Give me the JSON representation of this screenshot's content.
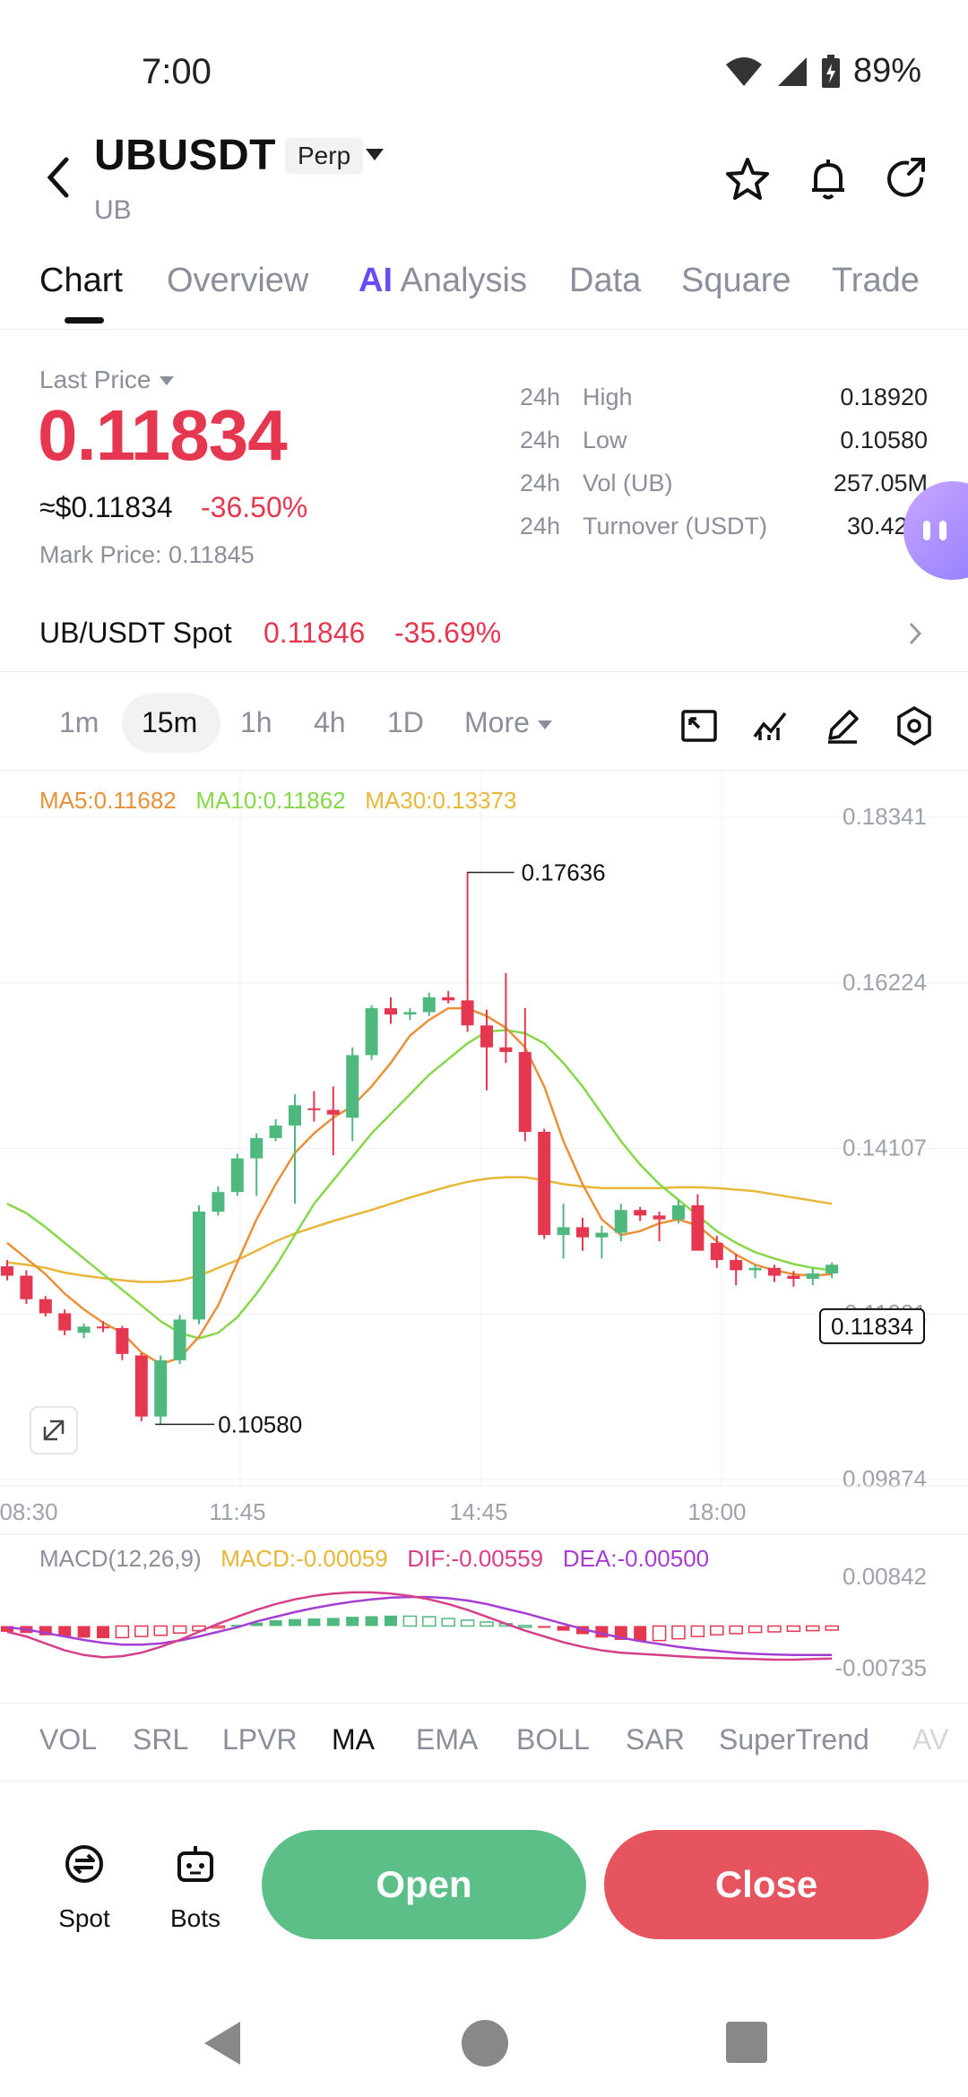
{
  "status_bar": {
    "time": "7:00",
    "battery": "89%"
  },
  "header": {
    "symbol": "UBUSDT",
    "contract_type": "Perp",
    "base": "UB"
  },
  "tabs": [
    "Chart",
    "Overview",
    "Analysis",
    "Data",
    "Square",
    "Trade"
  ],
  "tab_ai_prefix": "AI",
  "price": {
    "label": "Last Price",
    "last": "0.11834",
    "usd": "≈$0.11834",
    "change": "-36.50%",
    "mark": "Mark Price: 0.11845"
  },
  "stats": [
    {
      "period": "24h",
      "key": "High",
      "value": "0.18920"
    },
    {
      "period": "24h",
      "key": "Low",
      "value": "0.10580"
    },
    {
      "period": "24h",
      "key": "Vol (UB)",
      "value": "257.05M"
    },
    {
      "period": "24h",
      "key": "Turnover (USDT)",
      "value": "30.42M"
    }
  ],
  "spot": {
    "name": "UB/USDT Spot",
    "price": "0.11846",
    "change": "-35.69%"
  },
  "intervals": [
    "1m",
    "15m",
    "1h",
    "4h",
    "1D",
    "More"
  ],
  "selected_interval": "15m",
  "ma_legend": {
    "ma5": "MA5:0.11682",
    "ma10": "MA10:0.11862",
    "ma30": "MA30:0.13373"
  },
  "colors": {
    "up": "#4fb87f",
    "down": "#e5374f",
    "ma5": "#e8913a",
    "ma10": "#86d84a",
    "ma30": "#e8b73a",
    "macd_dif": "#d6408a",
    "macd_dea": "#a53fd3"
  },
  "chart_data": {
    "type": "candlestick",
    "y_ticks": [
      "0.18341",
      "0.16224",
      "0.14107",
      "0.11991",
      "0.09874"
    ],
    "x_ticks": [
      "08:30",
      "11:45",
      "14:45",
      "18:00"
    ],
    "high_label": "0.17636",
    "low_label": "0.10580",
    "current_label": "0.11834",
    "ylim": [
      0.09874,
      0.18341
    ],
    "candles": [
      [
        0.126,
        0.1268,
        0.1242,
        0.1248
      ],
      [
        0.1248,
        0.1255,
        0.1212,
        0.1218
      ],
      [
        0.1218,
        0.1222,
        0.1196,
        0.12
      ],
      [
        0.12,
        0.1205,
        0.1172,
        0.1178
      ],
      [
        0.1175,
        0.1187,
        0.1168,
        0.1183
      ],
      [
        0.1183,
        0.119,
        0.1176,
        0.1181
      ],
      [
        0.1181,
        0.1184,
        0.114,
        0.1148
      ],
      [
        0.1146,
        0.1149,
        0.1062,
        0.1068
      ],
      [
        0.1068,
        0.1146,
        0.1058,
        0.114
      ],
      [
        0.114,
        0.1198,
        0.1135,
        0.1192
      ],
      [
        0.1192,
        0.1338,
        0.1186,
        0.133
      ],
      [
        0.133,
        0.1362,
        0.1325,
        0.1355
      ],
      [
        0.1355,
        0.1404,
        0.135,
        0.1398
      ],
      [
        0.1398,
        0.143,
        0.135,
        0.1424
      ],
      [
        0.1424,
        0.1448,
        0.142,
        0.144
      ],
      [
        0.144,
        0.148,
        0.134,
        0.1466
      ],
      [
        0.1462,
        0.1484,
        0.1445,
        0.146
      ],
      [
        0.146,
        0.149,
        0.1402,
        0.1454
      ],
      [
        0.145,
        0.154,
        0.142,
        0.153
      ],
      [
        0.153,
        0.1594,
        0.1524,
        0.159
      ],
      [
        0.159,
        0.1604,
        0.157,
        0.1582
      ],
      [
        0.1582,
        0.159,
        0.1575,
        0.1585
      ],
      [
        0.1585,
        0.161,
        0.158,
        0.1604
      ],
      [
        0.1604,
        0.1612,
        0.1596,
        0.16
      ],
      [
        0.16,
        0.1764,
        0.156,
        0.1568
      ],
      [
        0.1568,
        0.1588,
        0.1485,
        0.154
      ],
      [
        0.154,
        0.1635,
        0.152,
        0.1534
      ],
      [
        0.1534,
        0.159,
        0.142,
        0.1432
      ],
      [
        0.1432,
        0.1436,
        0.1295,
        0.13
      ],
      [
        0.13,
        0.134,
        0.127,
        0.131
      ],
      [
        0.131,
        0.1322,
        0.128,
        0.1297
      ],
      [
        0.1297,
        0.1312,
        0.127,
        0.1303
      ],
      [
        0.1303,
        0.134,
        0.1292,
        0.1332
      ],
      [
        0.1332,
        0.1336,
        0.1318,
        0.1325
      ],
      [
        0.1325,
        0.133,
        0.1292,
        0.132
      ],
      [
        0.132,
        0.1345,
        0.1315,
        0.1338
      ],
      [
        0.1338,
        0.1352,
        0.13,
        0.128
      ],
      [
        0.129,
        0.1299,
        0.1258,
        0.1268
      ],
      [
        0.1268,
        0.1276,
        0.1236,
        0.1255
      ],
      [
        0.1255,
        0.1262,
        0.1245,
        0.1258
      ],
      [
        0.1258,
        0.1262,
        0.124,
        0.1248
      ],
      [
        0.1248,
        0.1254,
        0.1234,
        0.1244
      ],
      [
        0.1244,
        0.1258,
        0.1236,
        0.1251
      ],
      [
        0.1251,
        0.1265,
        0.1245,
        0.1262
      ]
    ],
    "ma5": [
      0.129,
      0.127,
      0.125,
      0.1225,
      0.1205,
      0.1188,
      0.1175,
      0.115,
      0.1135,
      0.1143,
      0.117,
      0.121,
      0.1265,
      0.132,
      0.1365,
      0.1405,
      0.143,
      0.145,
      0.1465,
      0.149,
      0.152,
      0.1555,
      0.1575,
      0.159,
      0.159,
      0.158,
      0.1565,
      0.154,
      0.149,
      0.142,
      0.1365,
      0.132,
      0.13,
      0.1305,
      0.1315,
      0.132,
      0.1312,
      0.1292,
      0.1275,
      0.1262,
      0.1255,
      0.125,
      0.1248,
      0.125
    ],
    "ma10": [
      0.134,
      0.1328,
      0.131,
      0.129,
      0.127,
      0.125,
      0.123,
      0.121,
      0.119,
      0.1175,
      0.1168,
      0.1175,
      0.1195,
      0.1225,
      0.126,
      0.13,
      0.134,
      0.137,
      0.14,
      0.143,
      0.1455,
      0.148,
      0.1505,
      0.1525,
      0.1545,
      0.156,
      0.1562,
      0.1558,
      0.1545,
      0.152,
      0.149,
      0.1455,
      0.142,
      0.139,
      0.1365,
      0.1345,
      0.1325,
      0.1305,
      0.129,
      0.1278,
      0.127,
      0.1263,
      0.1258,
      0.1255
    ],
    "ma30": [
      0.1265,
      0.1262,
      0.1258,
      0.1252,
      0.1248,
      0.1245,
      0.1242,
      0.124,
      0.124,
      0.1242,
      0.1248,
      0.1258,
      0.1268,
      0.128,
      0.1292,
      0.1302,
      0.131,
      0.1318,
      0.1325,
      0.1332,
      0.134,
      0.1348,
      0.1355,
      0.1362,
      0.1368,
      0.1372,
      0.1374,
      0.1374,
      0.137,
      0.1365,
      0.1362,
      0.136,
      0.136,
      0.136,
      0.136,
      0.1361,
      0.1361,
      0.136,
      0.1358,
      0.1356,
      0.1352,
      0.1348,
      0.1344,
      0.134
    ]
  },
  "macd": {
    "label": "MACD(12,26,9)",
    "macd": "MACD:-0.00059",
    "dif": "DIF:-0.00559",
    "dea": "DEA:-0.00500",
    "y_ticks": [
      "0.00842",
      "-0.00735"
    ],
    "ylim": [
      -0.00735,
      0.00842
    ],
    "hist": [
      -0.001,
      -0.0012,
      -0.0016,
      -0.0018,
      -0.002,
      -0.0021,
      -0.002,
      -0.0018,
      -0.0016,
      -0.0012,
      -0.0008,
      -0.0003,
      0.0002,
      0.0006,
      0.001,
      0.0012,
      0.0013,
      0.0014,
      0.0016,
      0.0017,
      0.0018,
      0.0017,
      0.0016,
      0.0013,
      0.001,
      0.0007,
      0.0004,
      0.0001,
      -0.0003,
      -0.0008,
      -0.0014,
      -0.002,
      -0.0024,
      -0.0026,
      -0.0025,
      -0.0022,
      -0.0018,
      -0.0015,
      -0.0013,
      -0.0011,
      -0.001,
      -0.0009,
      -0.0008,
      -0.0007
    ],
    "dif_line": [
      -0.001,
      -0.0018,
      -0.003,
      -0.0042,
      -0.005,
      -0.0054,
      -0.0052,
      -0.0046,
      -0.0036,
      -0.0024,
      -0.001,
      0.0004,
      0.0016,
      0.0028,
      0.0038,
      0.0046,
      0.0052,
      0.0056,
      0.0058,
      0.0058,
      0.0056,
      0.0052,
      0.0046,
      0.0038,
      0.0028,
      0.0016,
      0.0004,
      -0.0008,
      -0.0018,
      -0.0028,
      -0.0036,
      -0.0042,
      -0.0046,
      -0.0048,
      -0.005,
      -0.0052,
      -0.0054,
      -0.0055,
      -0.0056,
      -0.0057,
      -0.0058,
      -0.0058,
      -0.0057,
      -0.0056
    ],
    "dea_line": [
      -0.0002,
      -0.0006,
      -0.0012,
      -0.0018,
      -0.0024,
      -0.0029,
      -0.0032,
      -0.0032,
      -0.003,
      -0.0025,
      -0.0018,
      -0.001,
      -0.0002,
      0.0008,
      0.0016,
      0.0024,
      0.0031,
      0.0037,
      0.0042,
      0.0046,
      0.0049,
      0.005,
      0.005,
      0.0048,
      0.0044,
      0.0038,
      0.003,
      0.0022,
      0.0013,
      0.0004,
      -0.0005,
      -0.0013,
      -0.002,
      -0.0026,
      -0.0031,
      -0.0036,
      -0.004,
      -0.0043,
      -0.0046,
      -0.0048,
      -0.0049,
      -0.005,
      -0.005,
      -0.005
    ]
  },
  "indicators": [
    "VOL",
    "SRL",
    "LPVR",
    "MA",
    "EMA",
    "BOLL",
    "SAR",
    "SuperTrend",
    "AV"
  ],
  "selected_indicator": "MA",
  "bottom": {
    "spot": "Spot",
    "bots": "Bots",
    "open": "Open",
    "close": "Close"
  }
}
